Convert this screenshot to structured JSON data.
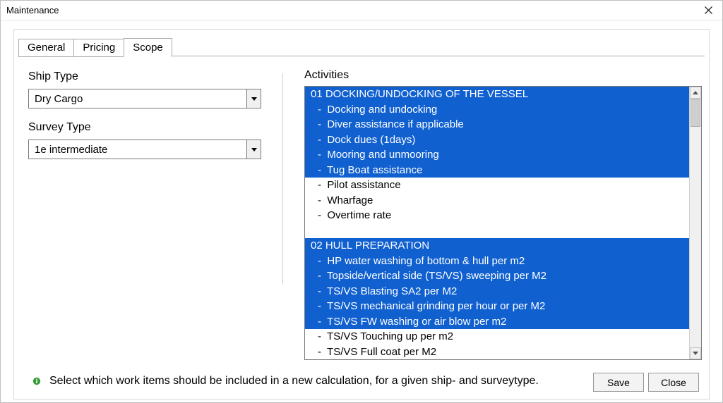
{
  "window": {
    "title": "Maintenance"
  },
  "tabs": {
    "general": "General",
    "pricing": "Pricing",
    "scope": "Scope"
  },
  "left": {
    "ship_type_label": "Ship Type",
    "ship_type_value": "Dry Cargo",
    "survey_type_label": "Survey Type",
    "survey_type_value": "1e intermediate"
  },
  "activities": {
    "label": "Activities",
    "rows": [
      {
        "text": "01 DOCKING/UNDOCKING OF THE VESSEL",
        "selected": true,
        "header": true
      },
      {
        "text": "Docking and undocking",
        "selected": true,
        "indent": true
      },
      {
        "text": "Diver assistance if applicable",
        "selected": true,
        "indent": true
      },
      {
        "text": "Dock dues (1days)",
        "selected": true,
        "indent": true
      },
      {
        "text": "Mooring and unmooring",
        "selected": true,
        "indent": true
      },
      {
        "text": "Tug Boat assistance",
        "selected": true,
        "indent": true
      },
      {
        "text": "Pilot assistance",
        "selected": false,
        "indent": true
      },
      {
        "text": "Wharfage",
        "selected": false,
        "indent": true
      },
      {
        "text": "Overtime rate",
        "selected": false,
        "indent": true
      },
      {
        "text": " ",
        "selected": false,
        "spacer": true
      },
      {
        "text": "02 HULL PREPARATION",
        "selected": true,
        "header": true
      },
      {
        "text": "HP water washing of bottom & hull per m2",
        "selected": true,
        "indent": true
      },
      {
        "text": "Topside/vertical side (TS/VS) sweeping per M2",
        "selected": true,
        "indent": true
      },
      {
        "text": "TS/VS Blasting SA2 per M2",
        "selected": true,
        "indent": true
      },
      {
        "text": "TS/VS mechanical grinding per hour or per M2",
        "selected": true,
        "indent": true
      },
      {
        "text": "TS/VS FW washing or air blow per m2",
        "selected": true,
        "indent": true
      },
      {
        "text": "TS/VS Touching up per m2",
        "selected": false,
        "indent": true
      },
      {
        "text": "TS/VS Full coat per M2",
        "selected": false,
        "indent": true
      }
    ]
  },
  "footer": {
    "helper": "Select which work items should be included in a new calculation, for a given ship- and surveytype.",
    "save": "Save",
    "close": "Close"
  }
}
